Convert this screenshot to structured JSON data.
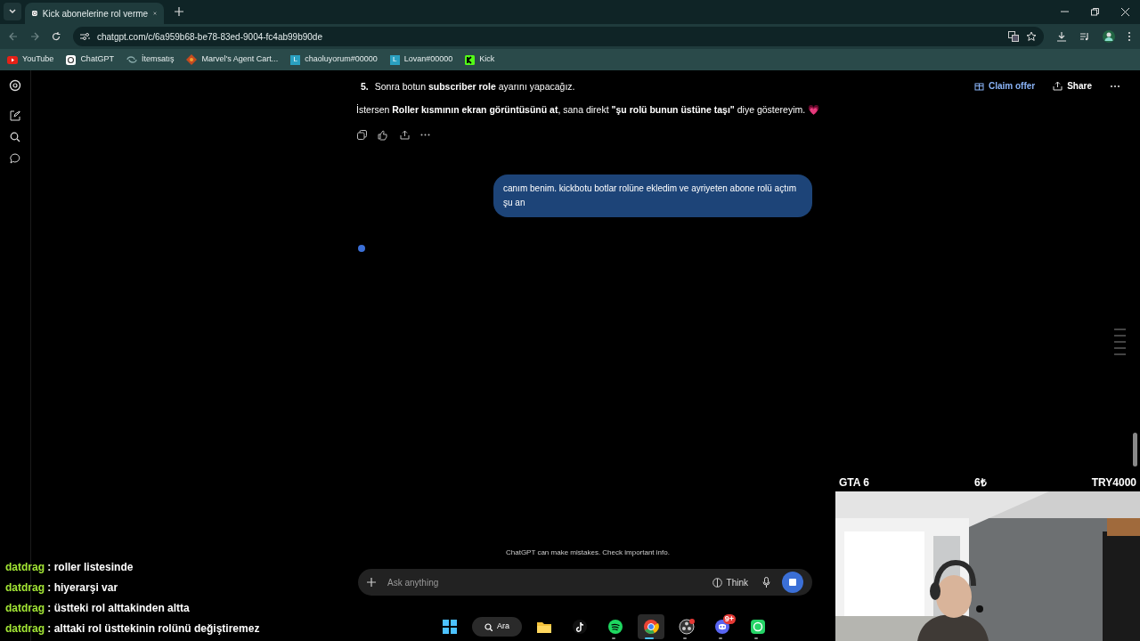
{
  "browser": {
    "tab_title": "Kick abonelerine rol verme",
    "url": "chatgpt.com/c/6a959b68-be78-83ed-9004-fc4ab99b90de",
    "bookmarks": [
      {
        "kind": "youtube",
        "label": "YouTube"
      },
      {
        "kind": "chatgpt",
        "label": "ChatGPT"
      },
      {
        "kind": "swirl",
        "label": "İtemsatış"
      },
      {
        "kind": "game",
        "label": "Marvel's Agent Cart..."
      },
      {
        "kind": "letter",
        "letter": "L",
        "label": "chaoluyorum#00000"
      },
      {
        "kind": "letter",
        "letter": "L",
        "label": "Lovan#00000"
      },
      {
        "kind": "kick",
        "label": "Kick"
      }
    ]
  },
  "header": {
    "claim_offer": "Claim offer",
    "share": "Share"
  },
  "conversation": {
    "list_item": {
      "number": "5.",
      "text": "Sonra botun **subscriber role** ayarını yapacağız."
    },
    "paragraph": "İstersen **Roller kısmının ekran görüntüsünü at**, sana direkt **\"şu rolü bunun üstüne taşı\"** diye göstereyim. 💗",
    "user_message": "canım benim. kickbotu botlar rolüne ekledim ve ayriyeten abone rolü açtım şu an"
  },
  "disclaimer": "ChatGPT can make mistakes. Check important info.",
  "composer": {
    "placeholder": "Ask anything",
    "think": "Think"
  },
  "stream_chat": [
    {
      "user": "datdrag",
      "text": ": roller listesinde"
    },
    {
      "user": "datdrag",
      "text": ": hiyerarşi var"
    },
    {
      "user": "datdrag",
      "text": ": üstteki rol alttakinden altta"
    },
    {
      "user": "datdrag",
      "text": ": alttaki rol üsttekinin rolünü değiştiremez"
    }
  ],
  "stream_bar": [
    "GTA 6",
    "6₺",
    "TRY4000"
  ],
  "taskbar": {
    "search": "Ara",
    "apps": [
      {
        "kind": "start",
        "running": false,
        "active": false
      },
      {
        "kind": "folder",
        "running": false,
        "active": false
      },
      {
        "kind": "tiktok",
        "running": false,
        "active": false
      },
      {
        "kind": "spotify",
        "running": true,
        "active": false
      },
      {
        "kind": "chrome",
        "active": true
      },
      {
        "kind": "obs",
        "running": true,
        "active": false
      },
      {
        "kind": "discord",
        "running": true,
        "active": false,
        "badge": "9+"
      },
      {
        "kind": "whatsapp",
        "running": true,
        "active": false
      }
    ]
  }
}
